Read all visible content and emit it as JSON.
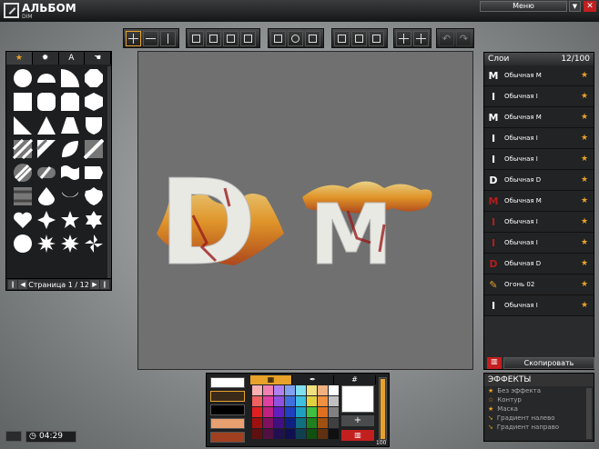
{
  "header": {
    "title": "АЛЬБОМ",
    "subtitle": "DIM",
    "menu_label": "Меню"
  },
  "shapes_panel": {
    "tabs": [
      "star-icon",
      "gear-icon",
      "A",
      "hand-icon"
    ],
    "pager_label": "Страница 1 / 12"
  },
  "canvas": {
    "text_left": "D",
    "text_right": "M"
  },
  "layers": {
    "title": "Слои",
    "count": "12/100",
    "items": [
      {
        "icon": "M",
        "name": "Обычная M"
      },
      {
        "icon": "I",
        "name": "Обычная I"
      },
      {
        "icon": "M",
        "name": "Обычная M"
      },
      {
        "icon": "I",
        "name": "Обычная I"
      },
      {
        "icon": "I",
        "name": "Обычная I"
      },
      {
        "icon": "D",
        "name": "Обычная D"
      },
      {
        "icon": "M",
        "name": "Обычная M"
      },
      {
        "icon": "I",
        "name": "Обычная I"
      },
      {
        "icon": "I",
        "name": "Обычная I"
      },
      {
        "icon": "D",
        "name": "Обычная D"
      },
      {
        "icon": "flame-icon",
        "name": "Огонь 02"
      },
      {
        "icon": "I",
        "name": "Обычная I"
      }
    ],
    "copy_label": "Скопировать"
  },
  "effects": {
    "title": "ЭФФЕКТЫ",
    "items": [
      "Без эффекта",
      "Контур",
      "Маска",
      "Градиент налево",
      "Градиент направо"
    ]
  },
  "color_panel": {
    "hash_label": "#",
    "add_label": "+",
    "opacity": "100"
  },
  "status": {
    "time": "04:29"
  },
  "colors": {
    "accent": "#e8a22a",
    "close": "#c21f1f",
    "canvas_bg": "#707070"
  }
}
